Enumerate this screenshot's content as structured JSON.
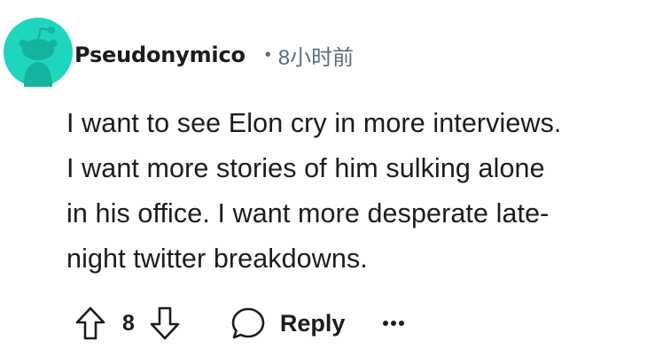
{
  "comment": {
    "username": "Pseudonymico",
    "separator": "•",
    "timestamp": "8小时前",
    "body_lines": [
      "I want to see Elon cry in more interviews.",
      "I want more stories of him sulking alone",
      "in his office. I want more desperate late-",
      "night twitter breakdowns."
    ]
  },
  "actions": {
    "upvote_icon": "arrow-up-icon",
    "vote_count": "8",
    "downvote_icon": "arrow-down-icon",
    "reply_icon": "speech-bubble-icon",
    "reply_label": "Reply",
    "more_icon": "ellipsis-icon"
  },
  "colors": {
    "avatar_background": "#1ed6bd",
    "meta_text": "#576f76",
    "text": "#1c1c1c"
  }
}
